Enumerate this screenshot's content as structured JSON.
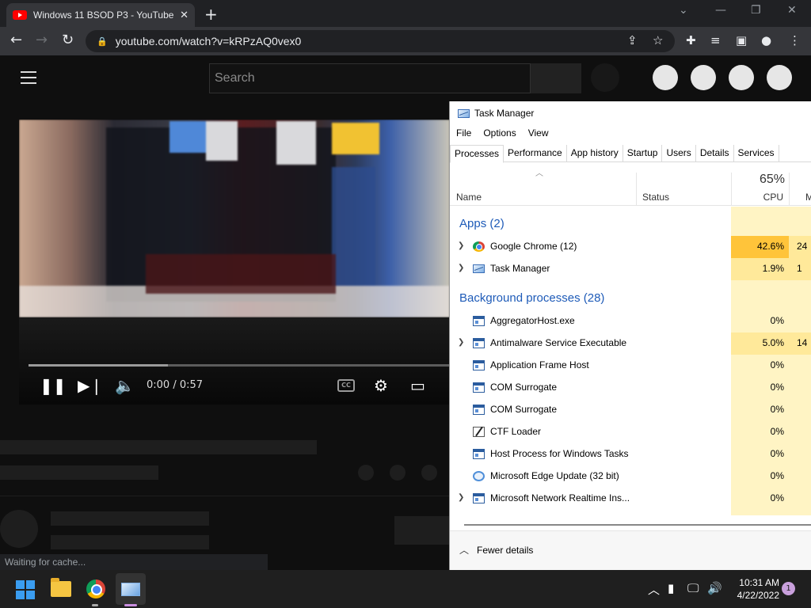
{
  "browser": {
    "tab_title": "Windows 11 BSOD P3 - YouTube",
    "url": "youtube.com/watch?v=kRPzAQ0vex0"
  },
  "youtube": {
    "search_placeholder": "Search",
    "player": {
      "time": "0:00 / 0:57",
      "cc_label": "CC",
      "progress_fraction": 0.33
    },
    "status_text": "Waiting for cache..."
  },
  "task_manager": {
    "title": "Task Manager",
    "menu": [
      "File",
      "Options",
      "View"
    ],
    "tabs": [
      "Processes",
      "Performance",
      "App history",
      "Startup",
      "Users",
      "Details",
      "Services"
    ],
    "active_tab": "Processes",
    "columns": {
      "name": "Name",
      "status": "Status",
      "cpu_pct": "65%",
      "cpu_label": "CPU",
      "mem_label": "M"
    },
    "groups": [
      {
        "label": "Apps (2)"
      },
      {
        "label": "Background processes (28)"
      }
    ],
    "apps": [
      {
        "name": "Google Chrome (12)",
        "cpu": "42.6%",
        "mem": "24",
        "expandable": true,
        "icon": "chrome-icon"
      },
      {
        "name": "Task Manager",
        "cpu": "1.9%",
        "mem": "1",
        "expandable": true,
        "icon": "task-manager-icon"
      }
    ],
    "background": [
      {
        "name": "AggregatorHost.exe",
        "cpu": "0%",
        "mem": "",
        "expandable": false,
        "icon": "window-icon"
      },
      {
        "name": "Antimalware Service Executable",
        "cpu": "5.0%",
        "mem": "14",
        "expandable": true,
        "icon": "window-icon"
      },
      {
        "name": "Application Frame Host",
        "cpu": "0%",
        "mem": "",
        "expandable": false,
        "icon": "window-icon"
      },
      {
        "name": "COM Surrogate",
        "cpu": "0%",
        "mem": "",
        "expandable": false,
        "icon": "window-icon"
      },
      {
        "name": "COM Surrogate",
        "cpu": "0%",
        "mem": "",
        "expandable": false,
        "icon": "window-icon"
      },
      {
        "name": "CTF Loader",
        "cpu": "0%",
        "mem": "",
        "expandable": false,
        "icon": "pen-icon"
      },
      {
        "name": "Host Process for Windows Tasks",
        "cpu": "0%",
        "mem": "",
        "expandable": false,
        "icon": "window-icon"
      },
      {
        "name": "Microsoft Edge Update (32 bit)",
        "cpu": "0%",
        "mem": "",
        "expandable": false,
        "icon": "update-icon"
      },
      {
        "name": "Microsoft Network Realtime Ins...",
        "cpu": "0%",
        "mem": "",
        "expandable": true,
        "icon": "window-icon"
      }
    ],
    "footer": "Fewer details"
  },
  "taskbar": {
    "time": "10:31 AM",
    "date": "4/22/2022",
    "notifications": "1"
  },
  "colors": {
    "cpu_hot": "#ffc43a",
    "cpu_med": "#ffe99a",
    "cpu_base": "#fff4c4",
    "group_text": "#1e5bb8"
  }
}
